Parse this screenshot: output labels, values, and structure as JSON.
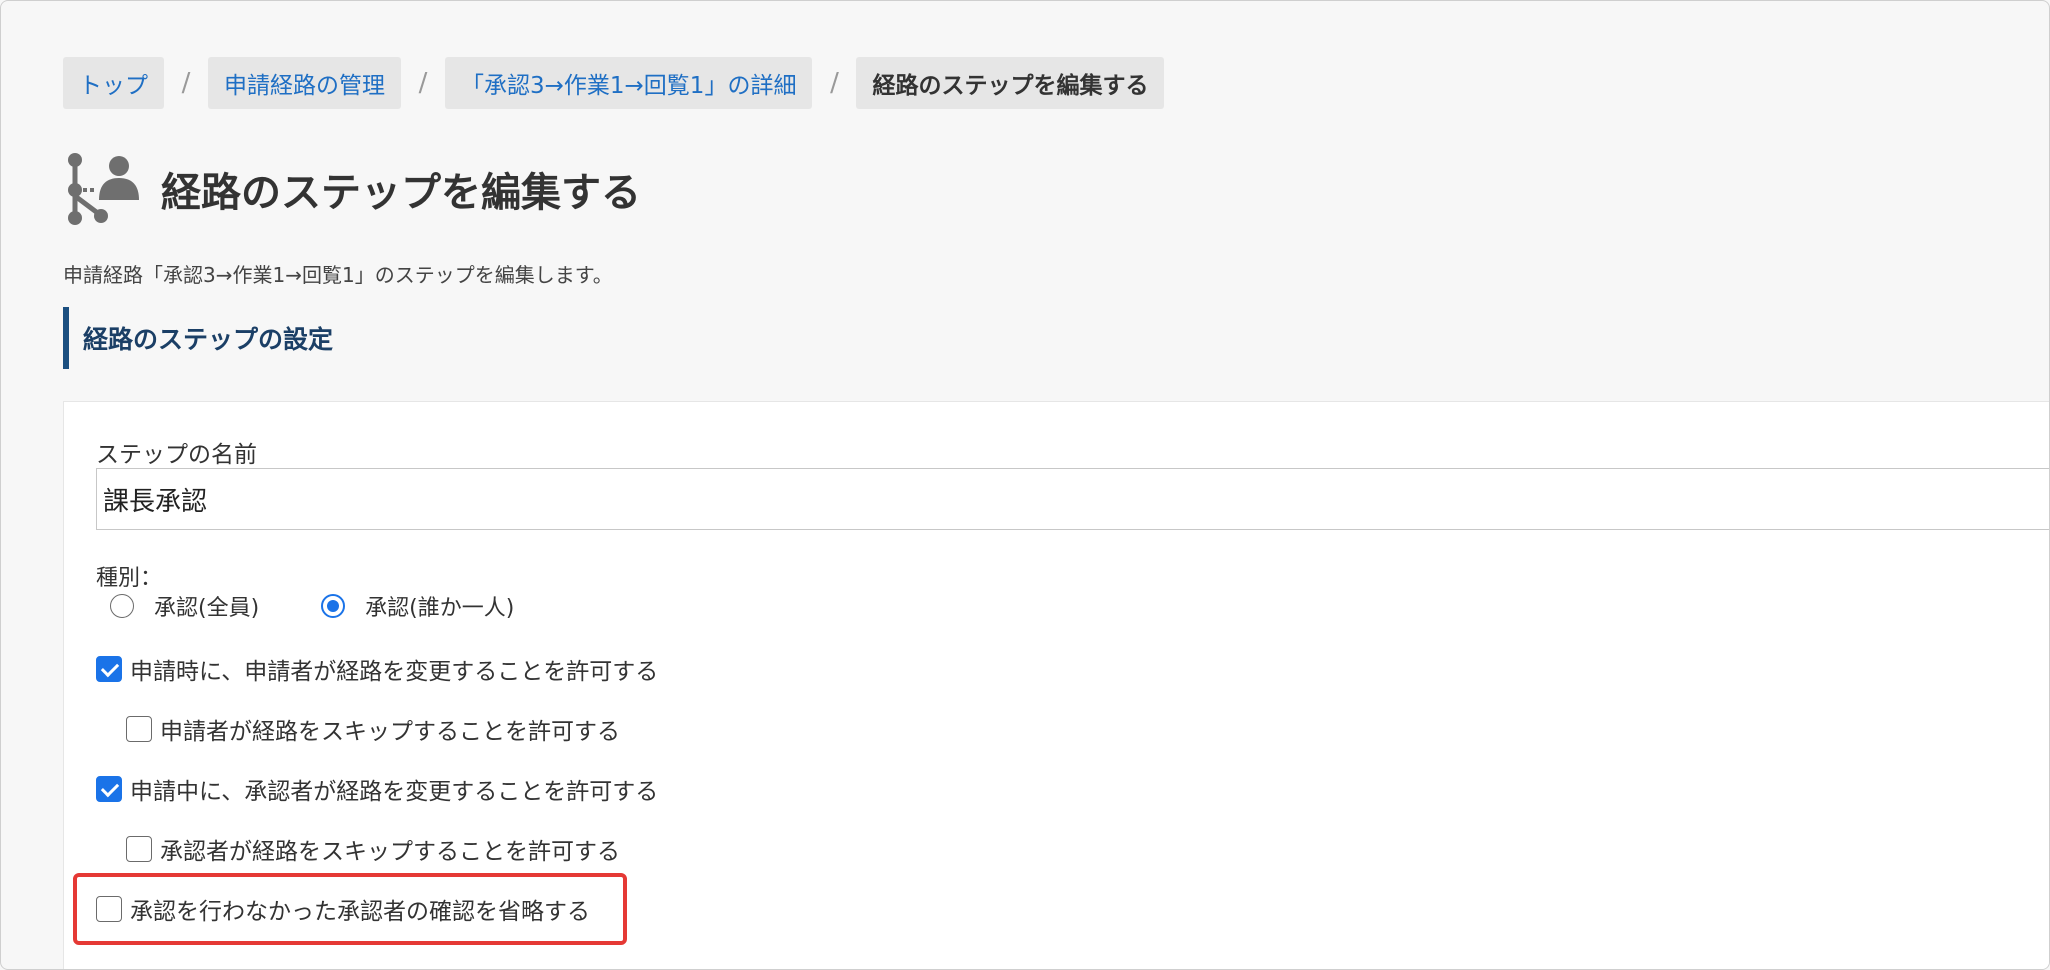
{
  "breadcrumb": {
    "items": [
      {
        "label": "トップ"
      },
      {
        "label": "申請経路の管理"
      },
      {
        "label": "「承認3→作業1→回覧1」の詳細"
      },
      {
        "label": "経路のステップを編集する"
      }
    ],
    "separator": "/"
  },
  "page": {
    "title": "経路のステップを編集する",
    "title_icon": "route-person-icon",
    "description": "申請経路「承認3→作業1→回覧1」のステップを編集します。",
    "section_heading": "経路のステップの設定"
  },
  "form": {
    "step_name_label": "ステップの名前",
    "step_name_value": "課長承認",
    "type_label": "種別：",
    "type_options": [
      {
        "label": "承認(全員)",
        "selected": false
      },
      {
        "label": "承認(誰か一人)",
        "selected": true
      }
    ],
    "checkboxes": [
      {
        "label": "申請時に、申請者が経路を変更することを許可する",
        "checked": true
      },
      {
        "label": "申請者が経路をスキップすることを許可する",
        "checked": false
      },
      {
        "label": "申請中に、承認者が経路を変更することを許可する",
        "checked": true
      },
      {
        "label": "承認者が経路をスキップすることを許可する",
        "checked": false
      },
      {
        "label": "承認を行わなかった承認者の確認を省略する",
        "checked": false
      }
    ]
  },
  "colors": {
    "link": "#1f6fc4",
    "accent": "#1a73e8",
    "highlight": "#e53935",
    "section_bar": "#1b4f80"
  }
}
